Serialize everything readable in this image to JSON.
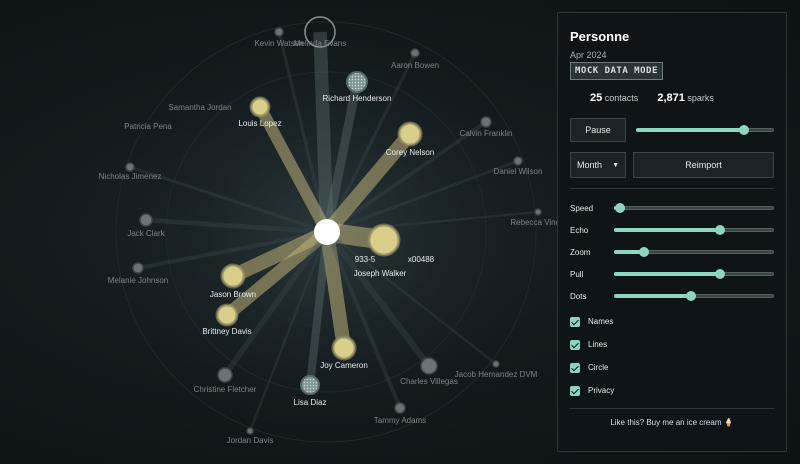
{
  "panel": {
    "title": "Personne",
    "date": "Apr 2024",
    "mode_badge": "MOCK DATA MODE",
    "contacts_count": "25",
    "contacts_label": "contacts",
    "sparks_count": "2,871",
    "sparks_label": "sparks",
    "pause_label": "Pause",
    "speed_slider_value": 0.78,
    "period_select": "Month",
    "reimport_label": "Reimport",
    "sliders": [
      {
        "label": "Speed",
        "value": 0.04
      },
      {
        "label": "Echo",
        "value": 0.66
      },
      {
        "label": "Zoom",
        "value": 0.19
      },
      {
        "label": "Pull",
        "value": 0.66
      },
      {
        "label": "Dots",
        "value": 0.48
      }
    ],
    "checkboxes": [
      {
        "label": "Names",
        "checked": true
      },
      {
        "label": "Lines",
        "checked": true
      },
      {
        "label": "Circle",
        "checked": true
      },
      {
        "label": "Privacy",
        "checked": true
      }
    ],
    "footer": "Like this? Buy me an ice cream 🍦"
  },
  "colors": {
    "accent": "#8ed4c0",
    "active_node": "#d9cf8a",
    "link": "#bfb178",
    "center": "#ffffff"
  },
  "graph": {
    "nodes": [
      {
        "name": "Kevin Watson",
        "state": "dim"
      },
      {
        "name": "Melinda Evans",
        "state": "ring"
      },
      {
        "name": "Aaron Bowen",
        "state": "dim"
      },
      {
        "name": "Richard Henderson",
        "state": "hatched"
      },
      {
        "name": "Samantha Jordan",
        "state": "dim"
      },
      {
        "name": "Louis Lopez",
        "state": "active"
      },
      {
        "name": "Patricia Pena",
        "state": "dim"
      },
      {
        "name": "Calvin Franklin",
        "state": "dim"
      },
      {
        "name": "Corey Nelson",
        "state": "active"
      },
      {
        "name": "Daniel Wilson",
        "state": "dim"
      },
      {
        "name": "Nicholas Jimenez",
        "state": "dim"
      },
      {
        "name": "Rebecca Vinc",
        "state": "dim"
      },
      {
        "name": "Jack Clark",
        "state": "dim"
      },
      {
        "name": "933-5",
        "state": "active"
      },
      {
        "name": "x00488",
        "state": "active"
      },
      {
        "name": "Joseph Walker",
        "state": "active"
      },
      {
        "name": "Melanie Johnson",
        "state": "dim"
      },
      {
        "name": "Jason Brown",
        "state": "active"
      },
      {
        "name": "Brittney Davis",
        "state": "active"
      },
      {
        "name": "Joy Cameron",
        "state": "active"
      },
      {
        "name": "Christine Fletcher",
        "state": "dim"
      },
      {
        "name": "Charles Villegas",
        "state": "dim"
      },
      {
        "name": "Jacob Hernandez DVM",
        "state": "dim"
      },
      {
        "name": "Lisa Diaz",
        "state": "hatched"
      },
      {
        "name": "Tammy Adams",
        "state": "dim"
      },
      {
        "name": "Jordan Davis",
        "state": "dim"
      }
    ]
  }
}
